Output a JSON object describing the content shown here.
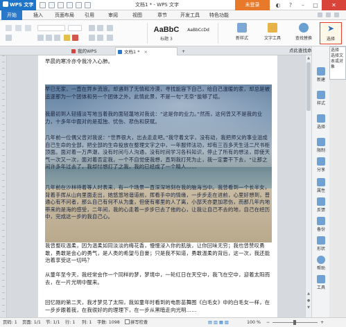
{
  "titlebar": {
    "app_name": "WPS 文字",
    "doc_title": "文档1 * - WPS 文字",
    "login_label": "未登录",
    "minimize": "–",
    "maximize": "□",
    "close": "✕"
  },
  "menu_tabs": [
    "开始",
    "插入",
    "页面布局",
    "引用",
    "审阅",
    "视图",
    "章节",
    "开发工具",
    "特色功能"
  ],
  "ribbon": {
    "style_heading3_sample": "AaBbC",
    "style_heading3_label": "标题 3",
    "style_normal_sample": "AaBbCcDd",
    "style_normal_label": "",
    "new_style_label": "新样式",
    "text_tools_label": "文字工具",
    "find_replace_label": "查找替换",
    "select_label": "选择"
  },
  "doc_tabs": [
    {
      "label": "我的WPS"
    },
    {
      "label": "文档1 *"
    }
  ],
  "doc_tab_new": "+",
  "original_hint": "点此查找命令",
  "document": {
    "p0": "早晨的寒冷亦令我冷入心肺。",
    "p1": "早已无家，一直在异乡流浪。却遇到了无情和冷漠，寻找能容下自己，给自己温暖的家，却总是被追逐那为一个团体和另一个团体之外。此情此景，不是一句“无奈”能够了结。",
    "p2": "我最初到人轻描淡写地当着我的面轻蔑地对我说：“这是你的业力。”然而，这何曾又不是我的业力，十多年中面对的是孤独、忧伤、悲伤和获赋。",
    "p3": "几年前一位偶父曾对我说：“世界很大，出去走走吧。”我守着文字，没有动，我把师父的事业溢成自己生命的全部，把全部的生命投放在整理文字之中，一年服师法功，却有三百多天生活二尺书柜顶面。面对着一万声潮，没有时间与人沟通，没有时间学习各科知识，停止了所有的想法，即使天气一次又一次，面对着否定我，一个不自觉使我想，直到我打死为止，我一定要干下去，“让那之间许多年过去了，我却忖想打了之我，我的已经成了一个精人……",
    "p4": "几年前在沙林待着等人时表来，有一个场景一直深深地刻在我的脑海当中。我曾看到一个长半女，背着手挥从山向里面走出，她悠悠地谐道前，挥看手中的情缘，一步步走在进前，心里好想到，普通心有不问者，那么自己有何不从为重，但使有哪里的人了离，小部天亦更加悲伤，而那几年内地带来的是海的感受，二年间，我的心走着一步步已去了他的心，让我让自己不去的地，自己在经历中，完成这一步的我自己心。",
    "p5": "我曾整叹温柔，因为温柔如同淡淡的梅花香，慢慢浸入你的肌肤，让你回味无穷；我也曾赞叹勇敢，勇敢是会心的勇气，是人类的希望与自豪；只是我不知道，勇敢温柔的背后，这一次，我还能治着享受这一切吗？",
    "p6": "从童年至今天，我经常会作一个同样的梦，梦境中，一轮红日在天空中，我飞在空中，迎着太阳而去，在一片光明中醒来。",
    "p7": "回忆刚的第二天，我才梦见了太阳，我如童年时看到的电影苗舞图《白毛女》中的白毛女一样，在一步步跟着我，在我很好的的理理下，在一步从黑暗走向光明……"
  },
  "right_pane": [
    "新建",
    "样式",
    "选择",
    "限制",
    "分享",
    "属性",
    "反馈",
    "备份",
    "形状",
    "帮助",
    "工具"
  ],
  "tooltip": {
    "title": "选择",
    "body": "选择文本或对象"
  },
  "statusbar": {
    "page": "页码: 1",
    "pages": "页面: 1/1",
    "section": "节: 1/1",
    "row": "行: 1",
    "col": "列: 1",
    "wordcount": "字数: 1098",
    "spellcheck": "拼写检查",
    "zoom": "100 %"
  },
  "colors": {
    "accent_blue": "#2a78c7",
    "login_orange": "#e8782a",
    "close_red": "#d8433a",
    "select_highlight": "#e43d2f"
  }
}
